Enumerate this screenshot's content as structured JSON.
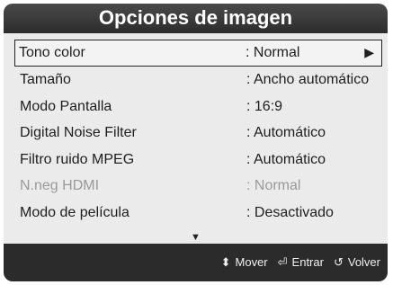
{
  "title": "Opciones de imagen",
  "items": [
    {
      "label": "Tono color",
      "value": ": Normal"
    },
    {
      "label": "Tamaño",
      "value": ": Ancho automático"
    },
    {
      "label": "Modo Pantalla",
      "value": ": 16:9"
    },
    {
      "label": "Digital Noise Filter",
      "value": ": Automático"
    },
    {
      "label": "Filtro ruido MPEG",
      "value": ": Automático"
    },
    {
      "label": "N.neg HDMI",
      "value": ": Normal"
    },
    {
      "label": "Modo de película",
      "value": ": Desactivado"
    }
  ],
  "help": {
    "move": "Mover",
    "enter": "Entrar",
    "back": "Volver"
  }
}
